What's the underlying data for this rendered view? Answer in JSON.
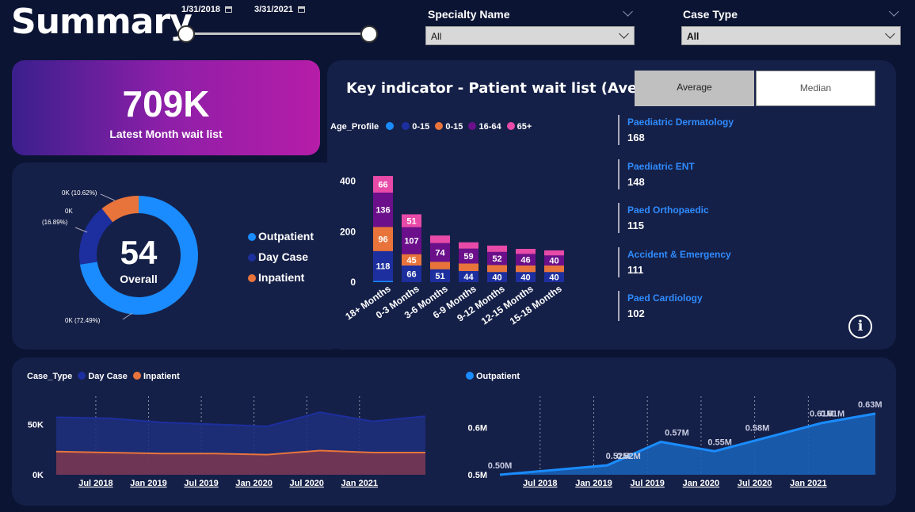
{
  "header": {
    "title": "Summary",
    "date_start": "1/31/2018",
    "date_end": "3/31/2021",
    "filters": [
      {
        "label": "Specialty Name",
        "value": "All"
      },
      {
        "label": "Case Type",
        "value": "All"
      }
    ]
  },
  "kpi": {
    "value": "709K",
    "label": "Latest Month wait list"
  },
  "donut": {
    "center_value": "54",
    "center_label": "Overall",
    "legend": [
      {
        "name": "Outpatient",
        "color": "#1a8cff"
      },
      {
        "name": "Day Case",
        "color": "#1d2f9e"
      },
      {
        "name": "Inpatient",
        "color": "#e8743b"
      }
    ],
    "slice_labels": [
      "0K (10.62%)",
      "0K",
      "(16.89%)",
      "0K (72.49%)"
    ]
  },
  "key_indicator": {
    "title": "Key indicator - Patient wait list (Average)",
    "buttons": [
      "Average",
      "Median"
    ],
    "legend_title": "Age_Profile",
    "legend_items": [
      {
        "name": "0-15",
        "color": "#1d2f9e"
      },
      {
        "name": "0-15",
        "color": "#e8743b"
      },
      {
        "name": "16-64",
        "color": "#6b0f8a"
      },
      {
        "name": "65+",
        "color": "#e84aa8"
      }
    ],
    "specialties": [
      {
        "name": "Paediatric Dermatology",
        "value": "168"
      },
      {
        "name": "Paediatric ENT",
        "value": "148"
      },
      {
        "name": "Paed Orthopaedic",
        "value": "115"
      },
      {
        "name": "Accident & Emergency",
        "value": "111"
      },
      {
        "name": "Paed Cardiology",
        "value": "102"
      }
    ],
    "info_icon": "i"
  },
  "bottom_left": {
    "legend_title": "Case_Type",
    "legend_items": [
      {
        "name": "Day Case",
        "color": "#1d2f9e"
      },
      {
        "name": "Inpatient",
        "color": "#e8743b"
      }
    ]
  },
  "bottom_right": {
    "legend_items": [
      {
        "name": "Outpatient",
        "color": "#1a8cff"
      }
    ]
  },
  "chart_data": [
    {
      "type": "pie",
      "categories": [
        "Outpatient",
        "Day Case",
        "Inpatient"
      ],
      "values": [
        72.49,
        16.89,
        10.62
      ],
      "data_labels": [
        "0K (72.49%)",
        "0K (16.89%)",
        "0K (10.62%)"
      ]
    },
    {
      "type": "bar",
      "stacked": true,
      "categories": [
        "18+ Months",
        "0-3 Months",
        "3-6 Months",
        "6-9 Months",
        "9-12 Months",
        "12-15 Months",
        "15-18 Months"
      ],
      "series": [
        {
          "name": "0-15",
          "color": "#1a8cff",
          "values": [
            5,
            0,
            0,
            0,
            0,
            0,
            0
          ]
        },
        {
          "name": "0-15",
          "color": "#1d2f9e",
          "values": [
            118,
            66,
            51,
            44,
            40,
            40,
            40
          ]
        },
        {
          "name": "0-15",
          "color": "#e8743b",
          "values": [
            96,
            45,
            30,
            30,
            28,
            26,
            26
          ]
        },
        {
          "name": "16-64",
          "color": "#6b0f8a",
          "values": [
            136,
            107,
            74,
            59,
            52,
            46,
            40
          ]
        },
        {
          "name": "65+",
          "color": "#e84aa8",
          "values": [
            66,
            51,
            30,
            25,
            25,
            20,
            20
          ]
        }
      ],
      "data_labels": {
        "0-15": [
          "118",
          "66",
          "51",
          "44",
          "40",
          "40",
          "40"
        ],
        "16-64": [
          "136",
          "107",
          "74",
          "59",
          "52",
          "46",
          "40"
        ],
        "65+": [
          "66",
          "51",
          "",
          "",
          "",
          "",
          ""
        ],
        "0-15 ": [
          "96",
          "45",
          "",
          "",
          "",
          "",
          ""
        ]
      },
      "yticks": [
        "0",
        "200",
        "400"
      ],
      "ylim": [
        0,
        440
      ]
    },
    {
      "type": "area",
      "x": [
        "Jan 2018",
        "Jul 2018",
        "Jan 2019",
        "Jul 2019",
        "Jan 2020",
        "Jul 2020",
        "Jan 2021",
        "Mar 2021"
      ],
      "xticks": [
        "Jul 2018",
        "Jan 2019",
        "Jul 2019",
        "Jan 2020",
        "Jul 2020",
        "Jan 2021"
      ],
      "yticks": [
        "0K",
        "50K"
      ],
      "ylim": [
        0,
        70
      ],
      "series": [
        {
          "name": "Day Case",
          "color": "#1d2f9e",
          "values": [
            57,
            56,
            52,
            50,
            48,
            62,
            53,
            58
          ]
        },
        {
          "name": "Inpatient",
          "color": "#e8743b",
          "values": [
            23,
            22,
            21,
            21,
            20,
            24,
            22,
            22
          ]
        }
      ]
    },
    {
      "type": "area",
      "x": [
        "Jan 2018",
        "Jul 2018",
        "Jan 2019",
        "Jul 2019",
        "Jan 2020",
        "Jul 2020",
        "Jan 2021",
        "Mar 2021"
      ],
      "xticks": [
        "Jul 2018",
        "Jan 2019",
        "Jul 2019",
        "Jan 2020",
        "Jul 2020",
        "Jan 2021"
      ],
      "yticks": [
        "0.5M",
        "0.6M"
      ],
      "ylim": [
        0.5,
        0.65
      ],
      "series": [
        {
          "name": "Outpatient",
          "color": "#1a8cff",
          "values": [
            0.5,
            0.51,
            0.52,
            0.57,
            0.55,
            0.58,
            0.61,
            0.63
          ]
        }
      ],
      "data_labels": [
        "0.50M",
        "0.52M",
        "0.52M",
        "0.57M",
        "0.55M",
        "0.58M",
        "0.61M",
        "0.61M",
        "0.63M"
      ]
    }
  ]
}
